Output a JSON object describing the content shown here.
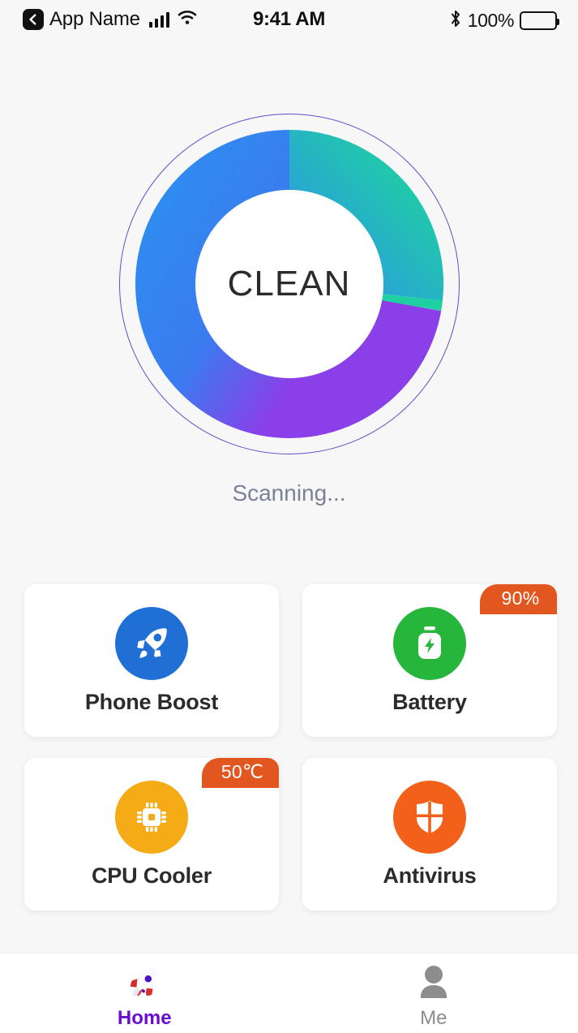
{
  "status_bar": {
    "back_icon": "chevron-left-icon",
    "app_name": "App Name",
    "signal_icon": "cellular-signal-icon",
    "wifi_icon": "wifi-icon",
    "time": "9:41 AM",
    "bluetooth_icon": "bluetooth-icon",
    "battery_percent": "100%",
    "battery_icon": "battery-full-icon"
  },
  "scanner": {
    "center_label": "CLEAN",
    "status_text": "Scanning...",
    "outer_ring_color": "#5b52c8"
  },
  "chart_data": {
    "type": "pie",
    "title": "CLEAN",
    "subtitle": "Scanning...",
    "categories": [
      "Blue segment",
      "Teal segment",
      "Purple segment"
    ],
    "values": [
      62,
      18,
      20
    ],
    "colors": [
      "#2f8cf0",
      "#1fd0a3",
      "#8b3fe8"
    ],
    "legend": "none",
    "inner_radius_ratio": 0.55,
    "start_angle_deg": 270,
    "notes": "Donut gauge: blue-to-teal gradient sweeps clockwise from top through right, teal segment ends at ~96 deg, purple segment from ~96 to ~168 deg, then blue-to-purple gradient continues around to top."
  },
  "features": [
    {
      "id": "phone-boost",
      "label": "Phone Boost",
      "icon": "rocket-icon",
      "circle_color": "#1f6fd4",
      "badge": null
    },
    {
      "id": "battery",
      "label": "Battery",
      "icon": "battery-charging-icon",
      "circle_color": "#27b63c",
      "badge": "90%",
      "badge_color": "#e2571f"
    },
    {
      "id": "cpu-cooler",
      "label": "CPU Cooler",
      "icon": "cpu-chip-icon",
      "circle_color": "#f5ab16",
      "badge": "50℃",
      "badge_color": "#e2571f"
    },
    {
      "id": "antivirus",
      "label": "Antivirus",
      "icon": "shield-icon",
      "circle_color": "#f2601a",
      "badge": null
    }
  ],
  "bottom_nav": {
    "items": [
      {
        "id": "home",
        "label": "Home",
        "icon": "rocket-emoji-icon",
        "active": true,
        "color": "#6a0dd0"
      },
      {
        "id": "me",
        "label": "Me",
        "icon": "person-icon",
        "active": false,
        "color": "#8d8d8d"
      }
    ]
  }
}
